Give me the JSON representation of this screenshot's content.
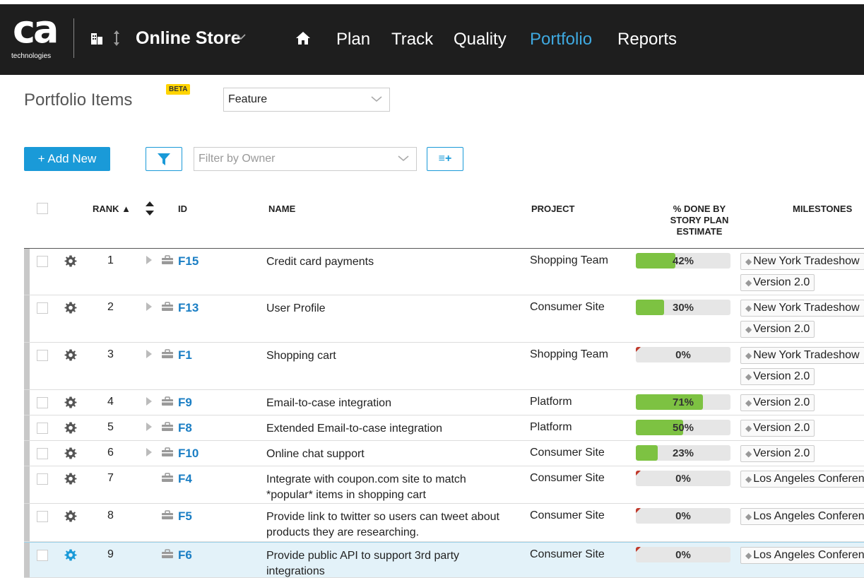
{
  "nav": {
    "logo_text": "ca",
    "logo_sub": "technologies",
    "project": "Online Store",
    "items": [
      "Plan",
      "Track",
      "Quality",
      "Portfolio",
      "Reports"
    ],
    "active": "Portfolio"
  },
  "page": {
    "title": "Portfolio Items",
    "beta": "BETA",
    "type_select": "Feature"
  },
  "toolbar": {
    "add_new": "+ Add New",
    "owner_placeholder": "Filter by Owner",
    "columns_icon": "≡+"
  },
  "table": {
    "headers": {
      "rank": "RANK ▲",
      "id": "ID",
      "name": "NAME",
      "project": "PROJECT",
      "pct_line1": "% DONE BY",
      "pct_line2": "STORY PLAN",
      "pct_line3": "ESTIMATE",
      "milestones": "MILESTONES"
    },
    "rows": [
      {
        "rank": "1",
        "id": "F15",
        "name": "Credit card payments",
        "project": "Shopping Team",
        "pct": 42,
        "pct_label": "42%",
        "milestones": [
          "New York Tradeshow",
          "Version 2.0"
        ],
        "expandable": true
      },
      {
        "rank": "2",
        "id": "F13",
        "name": "User Profile",
        "project": "Consumer Site",
        "pct": 30,
        "pct_label": "30%",
        "milestones": [
          "New York Tradeshow",
          "Version 2.0"
        ],
        "expandable": true
      },
      {
        "rank": "3",
        "id": "F1",
        "name": "Shopping cart",
        "project": "Shopping Team",
        "pct": 0,
        "pct_label": "0%",
        "milestones": [
          "New York Tradeshow",
          "Version 2.0"
        ],
        "expandable": true
      },
      {
        "rank": "4",
        "id": "F9",
        "name": "Email-to-case integration",
        "project": "Platform",
        "pct": 71,
        "pct_label": "71%",
        "milestones": [
          "Version 2.0"
        ],
        "expandable": true
      },
      {
        "rank": "5",
        "id": "F8",
        "name": "Extended Email-to-case integration",
        "project": "Platform",
        "pct": 50,
        "pct_label": "50%",
        "milestones": [
          "Version 2.0"
        ],
        "expandable": true
      },
      {
        "rank": "6",
        "id": "F10",
        "name": "Online chat support",
        "project": "Consumer Site",
        "pct": 23,
        "pct_label": "23%",
        "milestones": [
          "Version 2.0"
        ],
        "expandable": true
      },
      {
        "rank": "7",
        "id": "F4",
        "name": "Integrate with coupon.com site to match *popular* items in shopping cart",
        "project": "Consumer Site",
        "pct": 0,
        "pct_label": "0%",
        "milestones": [
          "Los Angeles Conference"
        ],
        "expandable": false
      },
      {
        "rank": "8",
        "id": "F5",
        "name": "Provide link to twitter so users can tweet about products they are researching.",
        "project": "Consumer Site",
        "pct": 0,
        "pct_label": "0%",
        "milestones": [
          "Los Angeles Conference"
        ],
        "expandable": false
      },
      {
        "rank": "9",
        "id": "F6",
        "name": "Provide public API to support 3rd party integrations",
        "project": "Consumer Site",
        "pct": 0,
        "pct_label": "0%",
        "milestones": [
          "Los Angeles Conference"
        ],
        "expandable": false,
        "selected": true
      }
    ]
  },
  "colors": {
    "nav_bg": "#1e1e1e",
    "accent": "#1a9ad8",
    "progress": "#7dc242",
    "flag": "#c0392b"
  }
}
